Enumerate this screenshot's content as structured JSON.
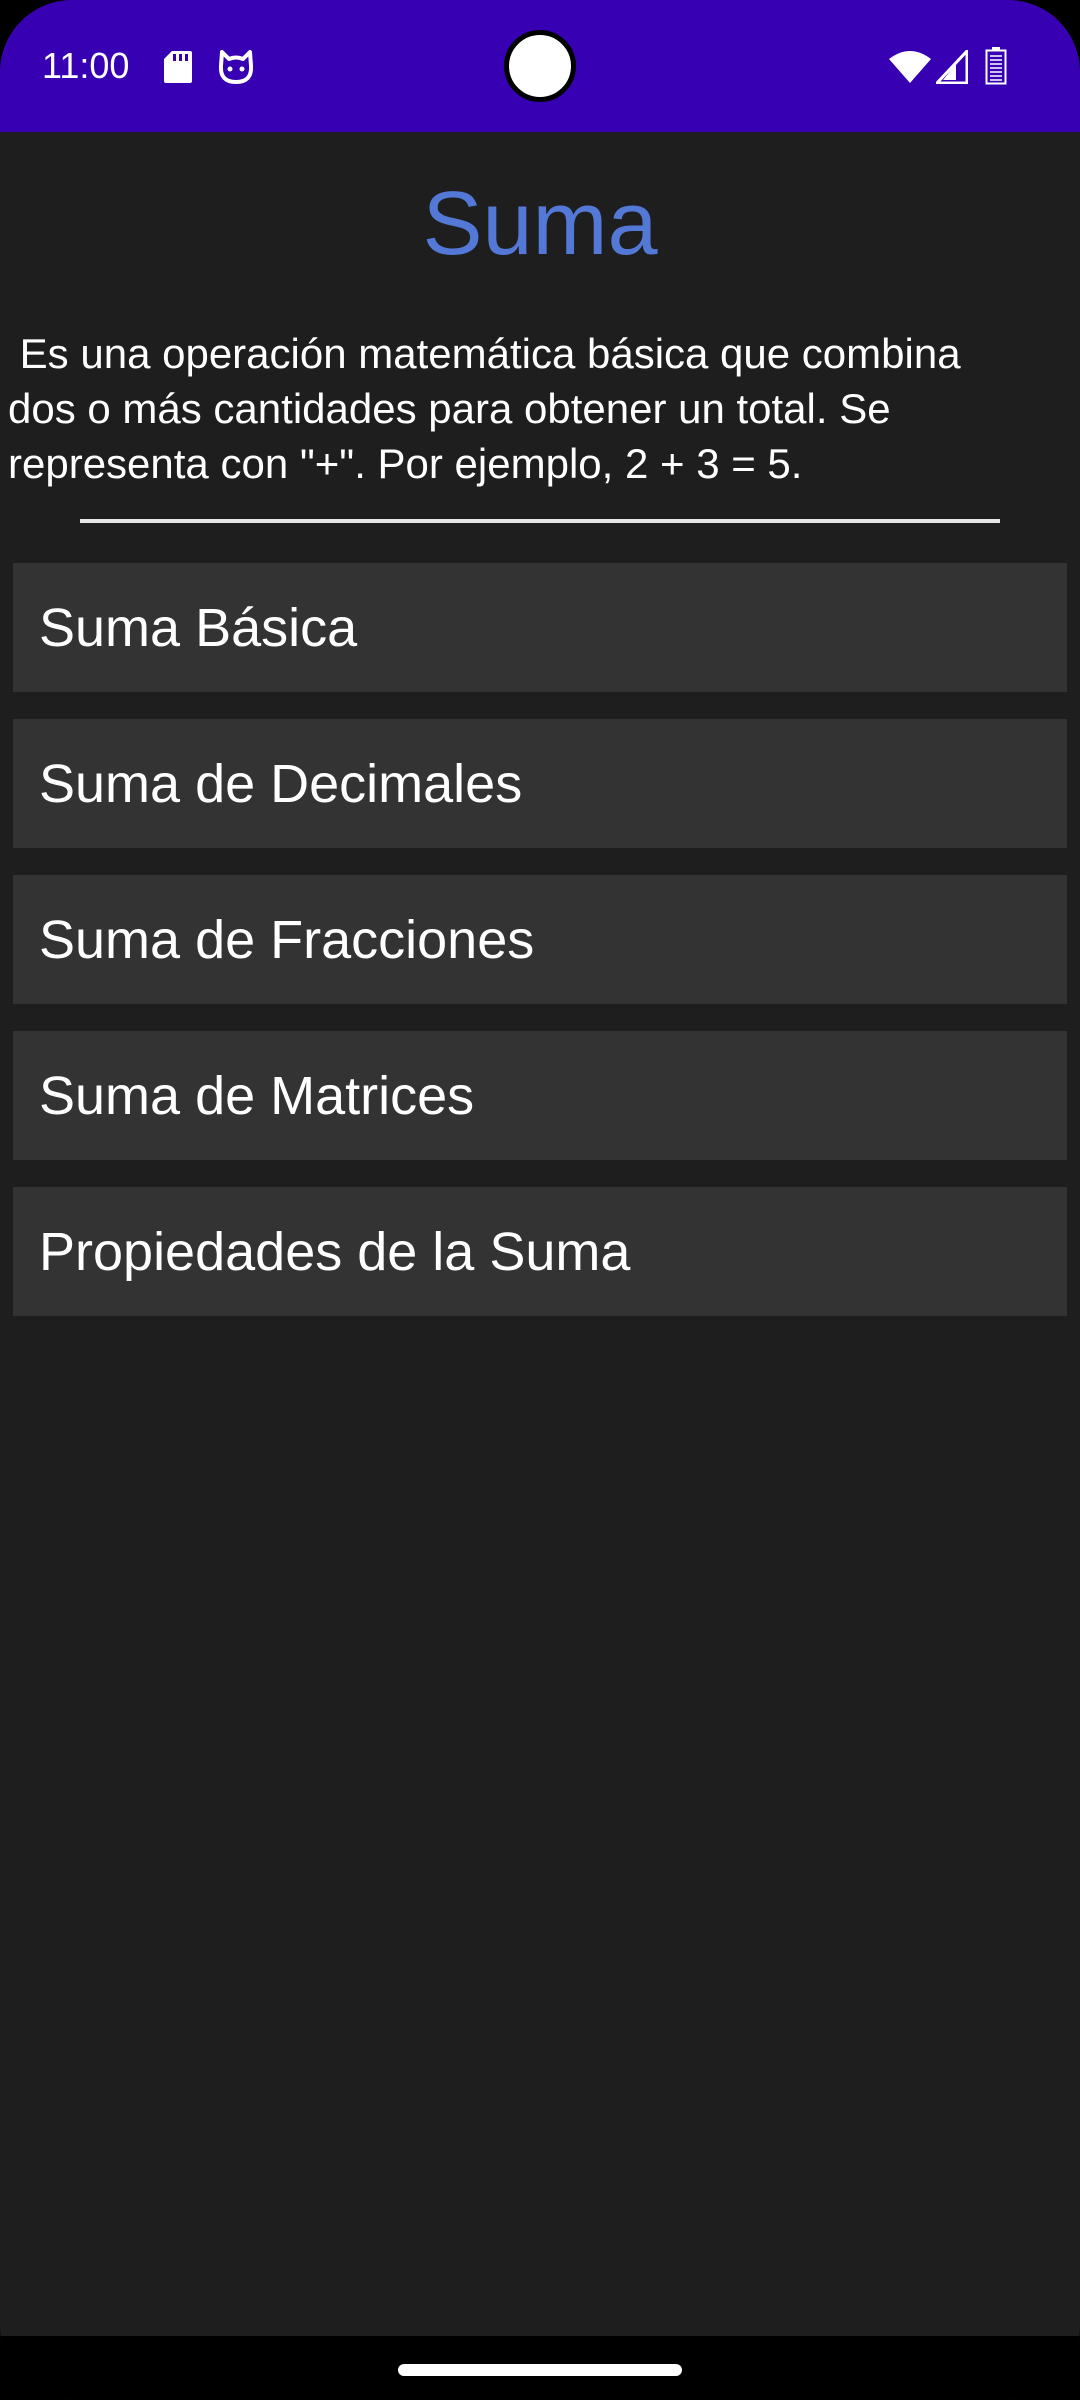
{
  "status_bar": {
    "time": "11:00",
    "background_color": "#3700b3",
    "icons": [
      "sd-card-icon",
      "cat-face-icon",
      "wifi-icon",
      "cell-signal-icon",
      "battery-icon"
    ]
  },
  "header": {
    "title": "Suma",
    "title_color": "#5478d6"
  },
  "description": " Es una operación matemática básica que combina\ndos o más cantidades para obtener un total. Se\nrepresenta con \"+\". Por ejemplo, 2 + 3 = 5.",
  "menu": {
    "items": [
      {
        "label": "Suma Básica"
      },
      {
        "label": "Suma de Decimales"
      },
      {
        "label": "Suma de Fracciones"
      },
      {
        "label": "Suma de Matrices"
      },
      {
        "label": "Propiedades de la Suma"
      }
    ]
  },
  "colors": {
    "background": "#1e1e1e",
    "menu_item_background": "#333333",
    "text": "#ffffff"
  }
}
